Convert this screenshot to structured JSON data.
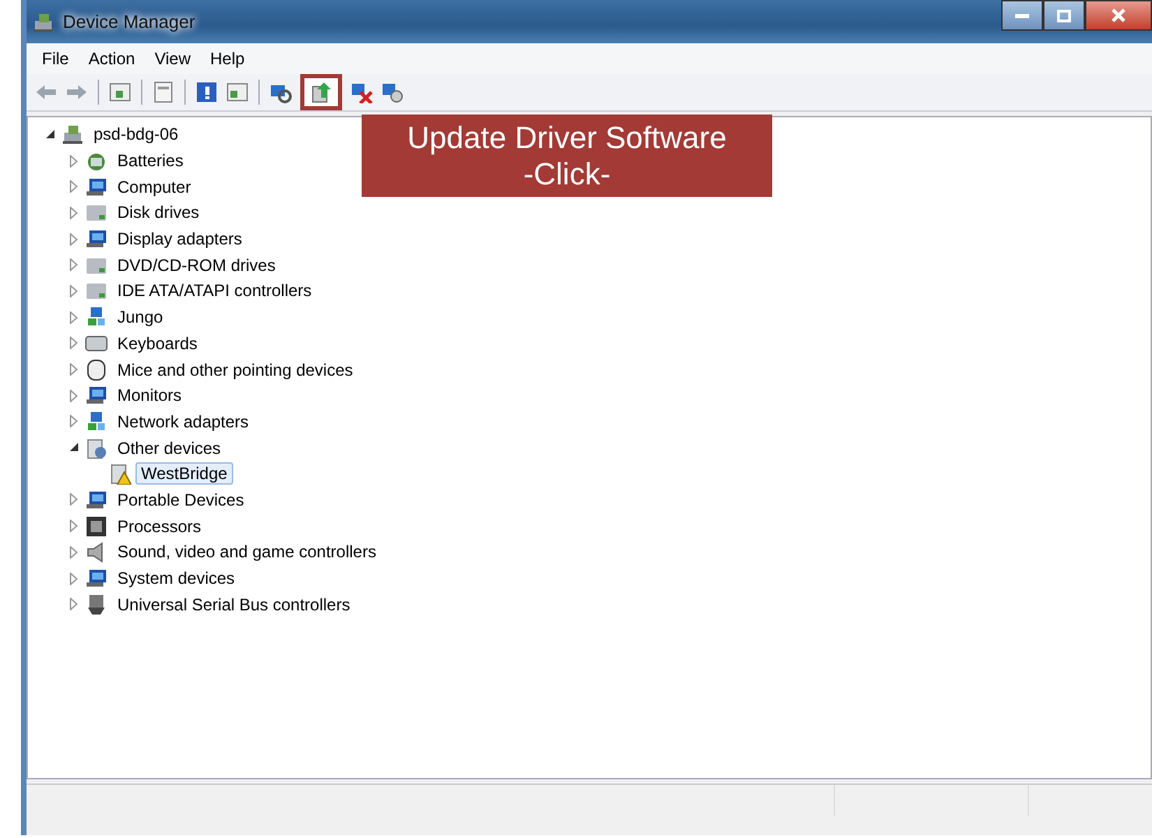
{
  "window": {
    "title": "Device Manager"
  },
  "menu": [
    "File",
    "Action",
    "View",
    "Help"
  ],
  "toolbar": [
    {
      "kind": "back",
      "highlighted": false
    },
    {
      "kind": "forward",
      "highlighted": false
    },
    {
      "kind": "separator"
    },
    {
      "kind": "tree",
      "highlighted": false
    },
    {
      "kind": "separator"
    },
    {
      "kind": "properties",
      "highlighted": false
    },
    {
      "kind": "separator"
    },
    {
      "kind": "help",
      "highlighted": false
    },
    {
      "kind": "panel",
      "highlighted": false
    },
    {
      "kind": "separator"
    },
    {
      "kind": "scan",
      "highlighted": false
    },
    {
      "kind": "update",
      "highlighted": true
    },
    {
      "kind": "disable",
      "highlighted": false
    },
    {
      "kind": "uninstall",
      "highlighted": false
    }
  ],
  "callout": {
    "lines": [
      "Update Driver Software",
      "-Click-"
    ]
  },
  "tree": [
    {
      "label": "psd-bdg-06",
      "kind": "computer",
      "expanded": true,
      "selected": false,
      "children": [
        {
          "label": "Batteries",
          "kind": "battery",
          "expanded": false,
          "selected": false
        },
        {
          "label": "Computer",
          "kind": "monitor",
          "expanded": false,
          "selected": false
        },
        {
          "label": "Disk drives",
          "kind": "drive",
          "expanded": false,
          "selected": false
        },
        {
          "label": "Display adapters",
          "kind": "monitor",
          "expanded": false,
          "selected": false
        },
        {
          "label": "DVD/CD-ROM drives",
          "kind": "drive",
          "expanded": false,
          "selected": false
        },
        {
          "label": "IDE ATA/ATAPI controllers",
          "kind": "drive",
          "expanded": false,
          "selected": false
        },
        {
          "label": "Jungo",
          "kind": "network",
          "expanded": false,
          "selected": false
        },
        {
          "label": "Keyboards",
          "kind": "keyboard",
          "expanded": false,
          "selected": false
        },
        {
          "label": "Mice and other pointing devices",
          "kind": "mouse",
          "expanded": false,
          "selected": false
        },
        {
          "label": "Monitors",
          "kind": "monitor",
          "expanded": false,
          "selected": false
        },
        {
          "label": "Network adapters",
          "kind": "network",
          "expanded": false,
          "selected": false
        },
        {
          "label": "Other devices",
          "kind": "unknown",
          "expanded": true,
          "selected": false,
          "children": [
            {
              "label": "WestBridge",
              "kind": "warning",
              "selected": true
            }
          ]
        },
        {
          "label": "Portable Devices",
          "kind": "monitor",
          "expanded": false,
          "selected": false
        },
        {
          "label": "Processors",
          "kind": "chip",
          "expanded": false,
          "selected": false
        },
        {
          "label": "Sound, video and game controllers",
          "kind": "speaker",
          "expanded": false,
          "selected": false
        },
        {
          "label": "System devices",
          "kind": "monitor",
          "expanded": false,
          "selected": false
        },
        {
          "label": "Universal Serial Bus controllers",
          "kind": "usb",
          "expanded": false,
          "selected": false
        }
      ]
    }
  ]
}
